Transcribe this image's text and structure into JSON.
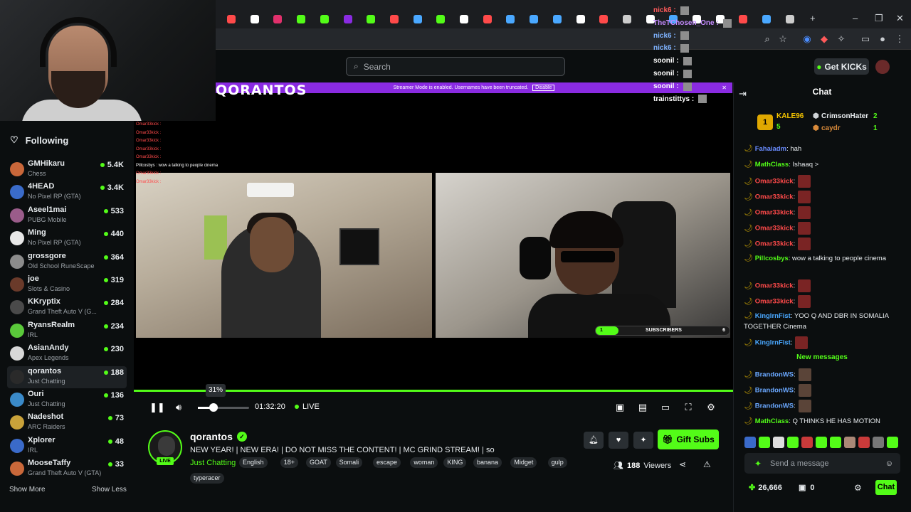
{
  "browser": {
    "tabs": [
      "",
      "",
      "",
      "",
      "",
      "",
      "",
      "",
      "",
      "",
      "",
      "",
      "",
      "",
      "",
      "",
      "",
      "",
      "",
      "",
      "",
      "",
      "",
      "",
      ""
    ],
    "window_controls": {
      "minimize": "–",
      "restore": "❐",
      "close": "✕"
    }
  },
  "floating_names": [
    {
      "name": "nick6 :",
      "color": "#ff5a5a"
    },
    {
      "name": "TheTChosen_One :",
      "color": "#c58bff"
    },
    {
      "name": "nick6 :",
      "color": "#7fb3ff"
    },
    {
      "name": "nick6 :",
      "color": "#7fb3ff"
    },
    {
      "name": "soonil :",
      "color": "#ffffff"
    },
    {
      "name": "soonil :",
      "color": "#ffffff"
    },
    {
      "name": "soonil :",
      "color": "#ffffff"
    },
    {
      "name": "trainstittys :",
      "color": "#ffffff"
    }
  ],
  "header": {
    "search_placeholder": "Search",
    "get_kicks": "Get KICKs"
  },
  "sidebar": {
    "following_label": "Following",
    "channels": [
      {
        "name": "GMHikaru",
        "category": "Chess",
        "viewers": "5.4K",
        "color": "#c9673a"
      },
      {
        "name": "4HEAD",
        "category": "No Pixel RP (GTA)",
        "viewers": "3.4K",
        "color": "#3a6bc9"
      },
      {
        "name": "Aseel1mai",
        "category": "PUBG Mobile",
        "viewers": "533",
        "color": "#9a5c8a"
      },
      {
        "name": "Ming",
        "category": "No Pixel RP (GTA)",
        "viewers": "440",
        "color": "#e8e8e8"
      },
      {
        "name": "grossgore",
        "category": "Old School RuneScape",
        "viewers": "364",
        "color": "#8c8c8c"
      },
      {
        "name": "joe",
        "category": "Slots & Casino",
        "viewers": "319",
        "color": "#6a3a2a"
      },
      {
        "name": "KKryptix",
        "category": "Grand Theft Auto V (G...",
        "viewers": "284",
        "color": "#4a4a4a"
      },
      {
        "name": "RyansRealm",
        "category": "IRL",
        "viewers": "234",
        "color": "#5ac93a"
      },
      {
        "name": "AsianAndy",
        "category": "Apex Legends",
        "viewers": "230",
        "color": "#d8d8d8"
      },
      {
        "name": "qorantos",
        "category": "Just Chatting",
        "viewers": "188",
        "color": "#2a2a2a"
      },
      {
        "name": "Ouri",
        "category": "Just Chatting",
        "viewers": "136",
        "color": "#3a8ac9"
      },
      {
        "name": "Nadeshot",
        "category": "ARC Raiders",
        "viewers": "73",
        "color": "#c9a23a"
      },
      {
        "name": "Xplorer",
        "category": "IRL",
        "viewers": "48",
        "color": "#3a6ac9"
      },
      {
        "name": "MooseTaffy",
        "category": "Grand Theft Auto V (GTA)",
        "viewers": "33",
        "color": "#c9683a"
      }
    ],
    "show_more": "Show More",
    "show_less": "Show Less"
  },
  "banner": {
    "text": "Streamer Mode is enabled. Usernames have been truncated.",
    "disable": "Disable",
    "logo_text": "QORANTOS"
  },
  "video": {
    "overlay_chat": [
      {
        "text": "Omar33kick : ",
        "cls": "r"
      },
      {
        "text": "Omar33kick : ",
        "cls": "r"
      },
      {
        "text": "Omar33kick : ",
        "cls": "r"
      },
      {
        "text": "Omar33kick : ",
        "cls": "r"
      },
      {
        "text": "Omar33kick : ",
        "cls": "r"
      },
      {
        "text": "Pillcosbys : wow a talking to people cinema",
        "cls": "w"
      },
      {
        "text": "Omar33kick : ",
        "cls": "r"
      },
      {
        "text": "Omar33kick : ",
        "cls": "r"
      }
    ],
    "subscribers_label": "SUBSCRIBERS",
    "subscribers_count": "1",
    "subscribers_goal": "6",
    "subscribers_progress": 0.17
  },
  "player": {
    "volume_tooltip": "31%",
    "volume": 0.31,
    "time": "01:32:20",
    "live_label": "LIVE"
  },
  "stream": {
    "name": "qorantos",
    "live_badge": "LIVE",
    "title": "NEW YEAR! | NEW ERA! | DO NOT MISS THE CONTENT! | MC GRIND STREAM! | so",
    "category": "Just Chatting",
    "tags": [
      "English",
      "18+",
      "GOAT",
      "Somali",
      "escape",
      "woman",
      "KING",
      "banana",
      "Midget",
      "gulp",
      "typeracer"
    ],
    "viewers": "188",
    "viewers_label": "Viewers",
    "gift_subs": "Gift Subs"
  },
  "chat": {
    "title": "Chat",
    "leaderboard": {
      "first_name": "KALE96",
      "first_count": "5",
      "second_name": "CrimsonHater",
      "second_count": "2",
      "third_name": "caydr",
      "third_count": "1"
    },
    "messages": [
      {
        "user": "Fahaiadm",
        "color": "#6a8cff",
        "text": ": hah"
      },
      {
        "user": "MathClass",
        "color": "#53fc18",
        "text": ": Ishaaq >"
      },
      {
        "user": "Omar33kick",
        "color": "#ff4a4a",
        "text": ":"
      },
      {
        "user": "Omar33kick",
        "color": "#ff4a4a",
        "text": ":"
      },
      {
        "user": "Omar33kick",
        "color": "#ff4a4a",
        "text": ":"
      },
      {
        "user": "Omar33kick",
        "color": "#ff4a4a",
        "text": ":"
      },
      {
        "user": "Omar33kick",
        "color": "#ff4a4a",
        "text": ":"
      },
      {
        "user": "Pillcosbys",
        "color": "#53fc18",
        "text": ": wow a talking to people cinema"
      },
      {
        "user": "Omar33kick",
        "color": "#ff4a4a",
        "text": ":"
      },
      {
        "user": "Omar33kick",
        "color": "#ff4a4a",
        "text": ":"
      },
      {
        "user": "KingIrnFist",
        "color": "#4aa8ff",
        "text": ": YOO Q AND DBR IN SOMALIA TOGETHER Cinema"
      },
      {
        "user": "KingIrnFist",
        "color": "#4aa8ff",
        "text": ":"
      }
    ],
    "new_messages_label": "New messages",
    "new_msgs": [
      {
        "user": "BrandonWS",
        "color": "#6aa8ff",
        "text": ":"
      },
      {
        "user": "BrandonWS",
        "color": "#6aa8ff",
        "text": ":"
      },
      {
        "user": "BrandonWS",
        "color": "#6aa8ff",
        "text": ":"
      },
      {
        "user": "MathClass",
        "color": "#53fc18",
        "text": ": Q THINKS HE HAS MOTION"
      }
    ],
    "input_placeholder": "Send a message",
    "points": "26,666",
    "drops": "0",
    "send_label": "Chat"
  }
}
